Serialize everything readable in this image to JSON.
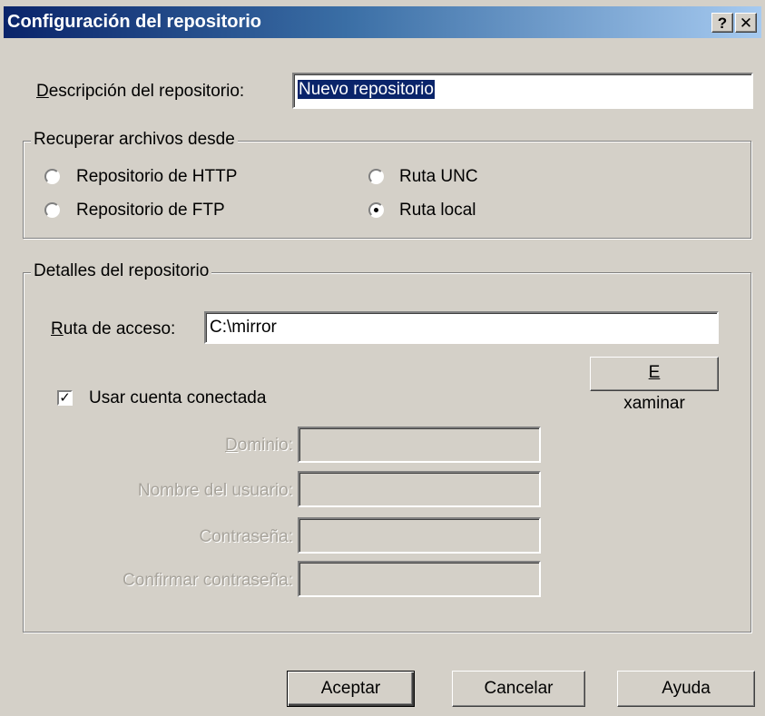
{
  "window": {
    "title": "Configuración del repositorio",
    "help_button": "?",
    "close_button": "✕"
  },
  "description": {
    "label_accel": "D",
    "label_rest": "escripción del repositorio:",
    "value": "Nuevo repositorio"
  },
  "retrieve": {
    "group_title": "Recuperar archivos desde",
    "options": [
      {
        "label": "Repositorio de HTTP",
        "checked": false
      },
      {
        "label": "Ruta UNC",
        "checked": false
      },
      {
        "label": "Repositorio de FTP",
        "checked": false
      },
      {
        "label": "Ruta local",
        "checked": true
      }
    ]
  },
  "details": {
    "group_title": "Detalles del repositorio",
    "path_label_accel": "R",
    "path_label_rest": "uta de acceso:",
    "path_value": "C:\\mirror",
    "browse_accel": "E",
    "browse_rest": "xaminar",
    "use_account_label": "Usar cuenta conectada",
    "use_account_checked": true,
    "domain_accel": "D",
    "domain_rest": "ominio:",
    "username_label": "Nombre del usuario:",
    "password_label": "Contraseña:",
    "confirm_label": "Confirmar contraseña:"
  },
  "buttons": {
    "ok": "Aceptar",
    "cancel": "Cancelar",
    "help": "Ayuda"
  }
}
